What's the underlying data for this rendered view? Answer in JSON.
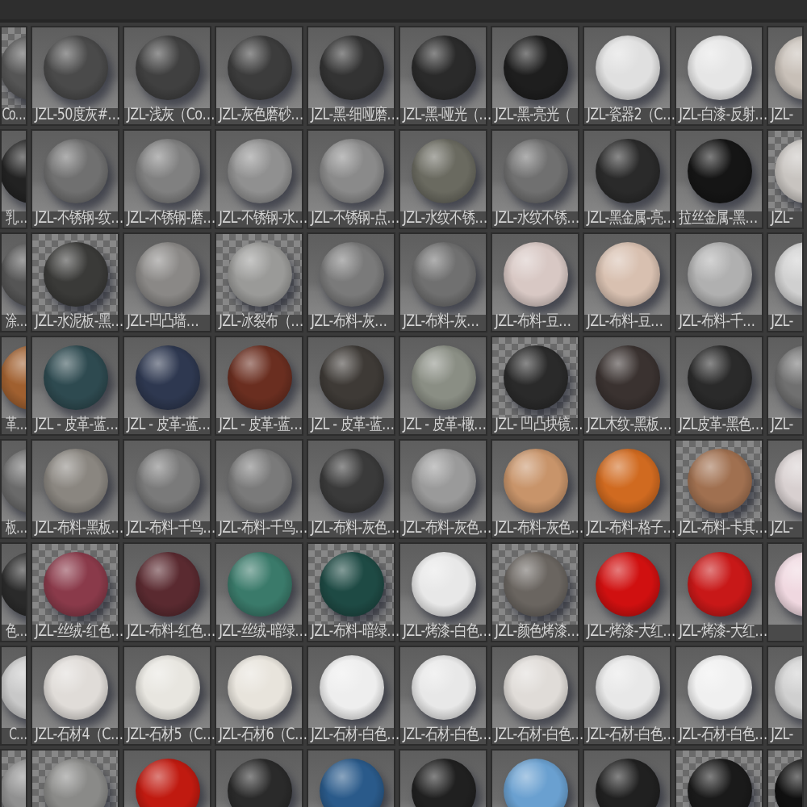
{
  "rows": [
    {
      "cells": [
        {
          "label": "Co…",
          "color": "#555555",
          "kind": "checker"
        },
        {
          "label": "JZL-50度灰#…",
          "color": "#4a4a4a",
          "kind": "plain"
        },
        {
          "label": "JZL-浅灰（Co…",
          "color": "#404040",
          "kind": "plain"
        },
        {
          "label": "JZL-灰色磨砂…",
          "color": "#3c3c3c",
          "kind": "plain"
        },
        {
          "label": "JZL-黑-细哑磨…",
          "color": "#333333",
          "kind": "plain"
        },
        {
          "label": "JZL-黑-哑光（…",
          "color": "#2a2a2a",
          "kind": "plain"
        },
        {
          "label": "JZL-黑-亮光（",
          "color": "#1e1e1e",
          "kind": "plain"
        },
        {
          "label": "JZL-瓷器2（C…",
          "color": "#e0e0e0",
          "kind": "plain"
        },
        {
          "label": "JZL-白漆-反射…",
          "color": "#e6e6e6",
          "kind": "plain"
        },
        {
          "label": "JZL-",
          "color": "#c8c0b8",
          "kind": "plain"
        }
      ]
    },
    {
      "cells": [
        {
          "label": "乳…",
          "color": "#222222",
          "kind": "plain"
        },
        {
          "label": "JZL-不锈钢-纹…",
          "color": "#707070",
          "kind": "plain"
        },
        {
          "label": "JZL-不锈钢-磨…",
          "color": "#808080",
          "kind": "plain"
        },
        {
          "label": "JZL-不锈钢-水…",
          "color": "#909090",
          "kind": "plain"
        },
        {
          "label": "JZL-不锈钢-点…",
          "color": "#8a8a8a",
          "kind": "plain"
        },
        {
          "label": "JZL-水纹不锈…",
          "color": "#6a6a60",
          "kind": "plain"
        },
        {
          "label": "JZL-水纹不锈…",
          "color": "#707070",
          "kind": "plain"
        },
        {
          "label": "JZL-黑金属-亮…",
          "color": "#2a2a2a",
          "kind": "plain"
        },
        {
          "label": "拉丝金属-黑…",
          "color": "#151515",
          "kind": "plain"
        },
        {
          "label": "JZL-",
          "color": "#c8c4c0",
          "kind": "checker"
        }
      ]
    },
    {
      "cells": [
        {
          "label": "涂…",
          "color": "#555555",
          "kind": "plain"
        },
        {
          "label": "JZL-水泥板-黑…",
          "color": "#3a3a38",
          "kind": "checker"
        },
        {
          "label": "JZL-凹凸墙…",
          "color": "#8a8886",
          "kind": "plain"
        },
        {
          "label": "JZL-冰裂布（…",
          "color": "#9a9a98",
          "kind": "checker"
        },
        {
          "label": "JZL-布料-灰…",
          "color": "#7a7a7a",
          "kind": "plain"
        },
        {
          "label": "JZL-布料-灰…",
          "color": "#707070",
          "kind": "plain"
        },
        {
          "label": "JZL-布料-豆…",
          "color": "#d8c8c4",
          "kind": "plain"
        },
        {
          "label": "JZL-布料-豆…",
          "color": "#d8c0b0",
          "kind": "plain"
        },
        {
          "label": "JZL-布料-千…",
          "color": "#b0b0b0",
          "kind": "plain"
        },
        {
          "label": "JZL-",
          "color": "#d0d0d0",
          "kind": "plain"
        }
      ]
    },
    {
      "cells": [
        {
          "label": "革…",
          "color": "#a06030",
          "kind": "plain"
        },
        {
          "label": "JZL - 皮革-蓝…",
          "color": "#2e4a50",
          "kind": "plain"
        },
        {
          "label": "JZL - 皮革-蓝…",
          "color": "#2e3850",
          "kind": "plain"
        },
        {
          "label": "JZL - 皮革-蓝…",
          "color": "#6a2e20",
          "kind": "plain"
        },
        {
          "label": "JZL - 皮革-蓝…",
          "color": "#3e3a36",
          "kind": "plain"
        },
        {
          "label": "JZL - 皮革-橄…",
          "color": "#8a8e84",
          "kind": "plain"
        },
        {
          "label": "JZL- 凹凸块镜…",
          "color": "#2a2a2a",
          "kind": "checker"
        },
        {
          "label": "JZL木纹-黑板…",
          "color": "#3a3230",
          "kind": "plain"
        },
        {
          "label": "JZL皮革-黑色…",
          "color": "#2a2a2a",
          "kind": "plain"
        },
        {
          "label": "JZL-",
          "color": "#707070",
          "kind": "plain"
        }
      ]
    },
    {
      "cells": [
        {
          "label": "板…",
          "color": "#6a6a6a",
          "kind": "plain"
        },
        {
          "label": "JZL-布料-黑板…",
          "color": "#8a8680",
          "kind": "plain"
        },
        {
          "label": "JZL-布料-千鸟…",
          "color": "#7a7a7a",
          "kind": "plain"
        },
        {
          "label": "JZL-布料-千鸟…",
          "color": "#7a7a7a",
          "kind": "plain"
        },
        {
          "label": "JZL-布料-灰色…",
          "color": "#3a3a3a",
          "kind": "plain"
        },
        {
          "label": "JZL-布料-灰色…",
          "color": "#9a9a9a",
          "kind": "plain"
        },
        {
          "label": "JZL-布料-灰色…",
          "color": "#c8946a",
          "kind": "plain"
        },
        {
          "label": "JZL-布料-格子…",
          "color": "#d06a20",
          "kind": "plain"
        },
        {
          "label": "JZL-布料-卡其…",
          "color": "#a07050",
          "kind": "checker"
        },
        {
          "label": "JZL-",
          "color": "#d8d0d0",
          "kind": "plain"
        }
      ]
    },
    {
      "cells": [
        {
          "label": "色…",
          "color": "#2a2a2a",
          "kind": "plain"
        },
        {
          "label": "JZL-丝绒-红色…",
          "color": "#8a3a4a",
          "kind": "checker"
        },
        {
          "label": "JZL-布料-红色…",
          "color": "#5a2a30",
          "kind": "plain"
        },
        {
          "label": "JZL-丝绒-暗绿…",
          "color": "#3a7a6a",
          "kind": "plain"
        },
        {
          "label": "JZL-布料-暗绿…",
          "color": "#1e4a44",
          "kind": "checker"
        },
        {
          "label": "JZL-烤漆-白色…",
          "color": "#e8e8e8",
          "kind": "plain"
        },
        {
          "label": "JZL-颜色烤漆…",
          "color": "#6a6560",
          "kind": "checker"
        },
        {
          "label": "JZL-烤漆-大红…",
          "color": "#d01010",
          "kind": "plain"
        },
        {
          "label": "JZL-烤漆-大红…",
          "color": "#c81818",
          "kind": "plain"
        },
        {
          "color": "#f0d8e0",
          "kind": "plain"
        }
      ]
    },
    {
      "cells": [
        {
          "label": "C…",
          "color": "#c8c8c8",
          "kind": "plain"
        },
        {
          "label": "JZL-石材4（C…",
          "color": "#e0dcd8",
          "kind": "plain"
        },
        {
          "label": "JZL-石材5（C…",
          "color": "#e8e6e0",
          "kind": "plain"
        },
        {
          "label": "JZL-石材6（C…",
          "color": "#e8e4dc",
          "kind": "plain"
        },
        {
          "label": "JZL-石材-白色…",
          "color": "#eeeeee",
          "kind": "plain"
        },
        {
          "label": "JZL-石材-白色…",
          "color": "#e8e8e8",
          "kind": "plain"
        },
        {
          "label": "JZL-石材-白色…",
          "color": "#e0dcd8",
          "kind": "plain"
        },
        {
          "label": "JZL-石材-白色…",
          "color": "#e8e8e8",
          "kind": "plain"
        },
        {
          "label": "JZL-石材-白色…",
          "color": "#f0f0f0",
          "kind": "plain"
        },
        {
          "label": "JZL-",
          "color": "#d0d0d0",
          "kind": "plain"
        }
      ]
    },
    {
      "cells": [
        {
          "color": "#909090",
          "kind": "checker"
        },
        {
          "color": "#8a8a88",
          "kind": "checker"
        },
        {
          "color": "#c01a10",
          "kind": "plain"
        },
        {
          "color": "#2a2a2a",
          "kind": "plain"
        },
        {
          "color": "#2a5a8a",
          "kind": "plain"
        },
        {
          "color": "#202020",
          "kind": "plain"
        },
        {
          "color": "#6aa0d0",
          "kind": "plain"
        },
        {
          "color": "#202020",
          "kind": "plain"
        },
        {
          "color": "#1a1a1a",
          "kind": "checker"
        },
        {
          "color": "#101010",
          "kind": "checker"
        }
      ]
    }
  ]
}
